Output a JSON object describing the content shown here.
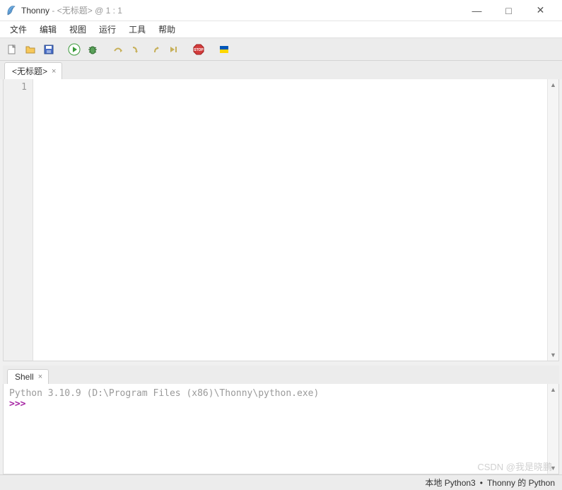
{
  "title": {
    "app": "Thonny",
    "sep": " - ",
    "doc": "<无标题>",
    "pos": " @ 1 : 1"
  },
  "winControls": {
    "min": "—",
    "max": "□",
    "close": "✕"
  },
  "menus": [
    "文件",
    "编辑",
    "视图",
    "运行",
    "工具",
    "帮助"
  ],
  "icons": {
    "new": "new-file-icon",
    "open": "open-folder-icon",
    "save": "save-disk-icon",
    "run": "play-icon",
    "debug": "bug-icon",
    "stepOver": "step-over-icon",
    "stepInto": "step-into-icon",
    "stepOut": "step-out-icon",
    "resume": "resume-icon",
    "stop": "stop-icon",
    "flag": "flag-icon"
  },
  "editorTab": {
    "label": "<无标题>",
    "close": "×"
  },
  "gutter": {
    "line1": "1"
  },
  "shellTab": {
    "label": "Shell",
    "close": "×"
  },
  "shell": {
    "banner": "Python 3.10.9 (D:\\Program Files (x86)\\Thonny\\python.exe)",
    "prompt": ">>>"
  },
  "status": {
    "left": "本地 Python3",
    "bullet": "•",
    "right": "Thonny 的 Python"
  },
  "watermark": "CSDN @我是晓鹏"
}
